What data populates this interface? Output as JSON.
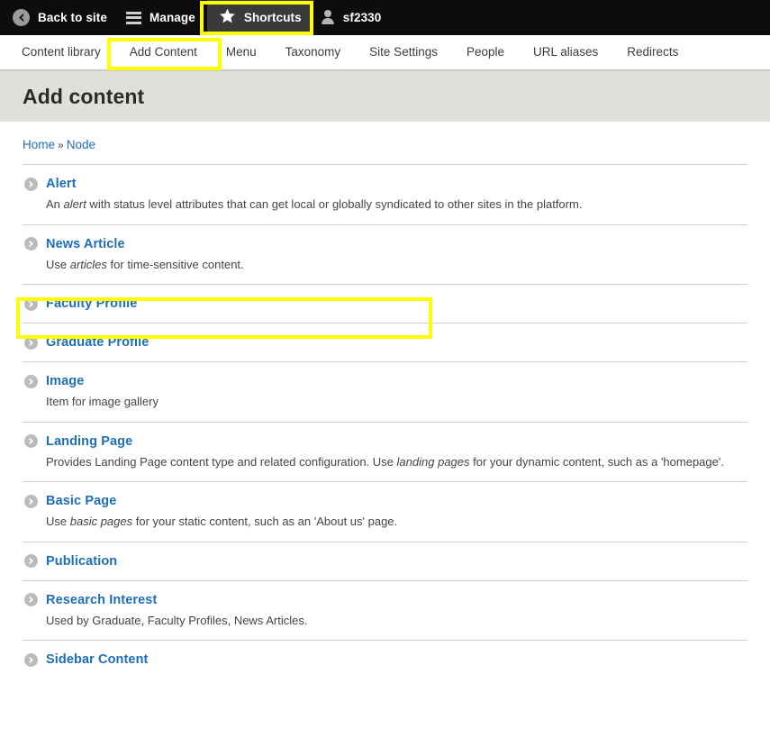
{
  "toolbar": {
    "back_label": "Back to site",
    "manage_label": "Manage",
    "shortcuts_label": "Shortcuts",
    "user_label": "sf2330",
    "highlight_color": "#ffff00",
    "background": "#0d0d0d"
  },
  "tabs": [
    {
      "label": "Content library"
    },
    {
      "label": "Add Content"
    },
    {
      "label": "Menu"
    },
    {
      "label": "Taxonomy"
    },
    {
      "label": "Site Settings"
    },
    {
      "label": "People"
    },
    {
      "label": "URL aliases"
    },
    {
      "label": "Redirects"
    }
  ],
  "page": {
    "title": "Add content",
    "title_bar_color": "#e0e0da",
    "link_color": "#1e6eb8"
  },
  "breadcrumb": {
    "home": "Home",
    "separator": "»",
    "current": "Node"
  },
  "content_types": [
    {
      "name": "Alert",
      "desc_html": "An <em>alert</em> with status level attributes that can get local or globally syndicated to other sites in the platform."
    },
    {
      "name": "News Article",
      "desc_html": "Use <em>articles</em> for time-sensitive content."
    },
    {
      "name": "Faculty Profile",
      "desc_html": ""
    },
    {
      "name": "Graduate Profile",
      "desc_html": ""
    },
    {
      "name": "Image",
      "desc_html": "Item for image gallery"
    },
    {
      "name": "Landing Page",
      "desc_html": "Provides Landing Page content type and related configuration. Use <em>landing pages</em> for your dynamic content, such as a 'homepage'."
    },
    {
      "name": "Basic Page",
      "desc_html": "Use <em>basic pages</em> for your static content, such as an 'About us' page."
    },
    {
      "name": "Publication",
      "desc_html": ""
    },
    {
      "name": "Research Interest",
      "desc_html": "Used by Graduate, Faculty Profiles, News Articles."
    },
    {
      "name": "Sidebar Content",
      "desc_html": ""
    }
  ]
}
